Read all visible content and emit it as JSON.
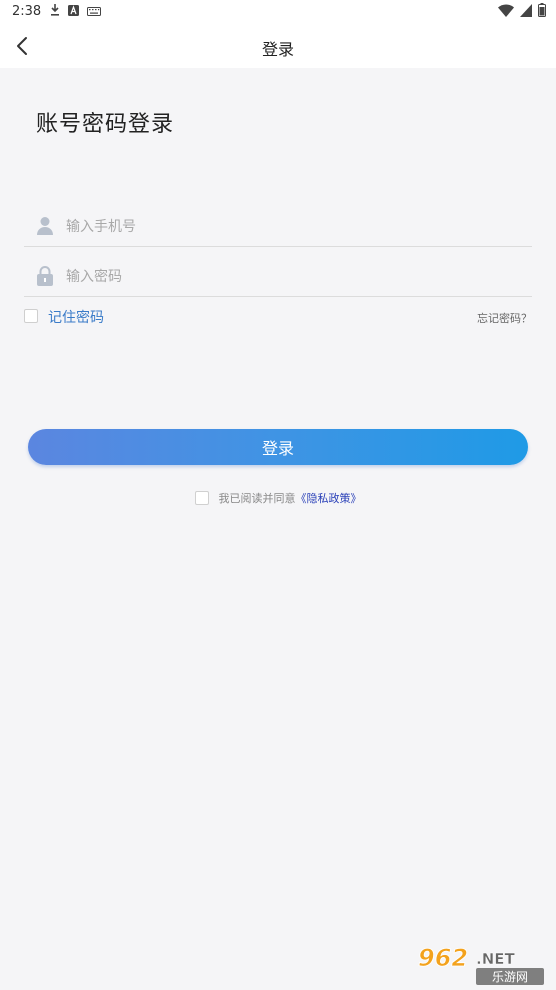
{
  "status_bar": {
    "time": "2:38",
    "icons_left": [
      "download-icon",
      "a-icon",
      "keyboard-icon"
    ],
    "icons_right": [
      "wifi-icon",
      "signal-icon",
      "battery-icon"
    ]
  },
  "nav": {
    "title": "登录",
    "back_icon": "chevron-left-icon"
  },
  "page": {
    "heading": "账号密码登录"
  },
  "form": {
    "phone": {
      "placeholder": "输入手机号",
      "value": "",
      "icon": "user-icon"
    },
    "password": {
      "placeholder": "输入密码",
      "value": "",
      "icon": "lock-icon"
    },
    "remember_label": "记住密码",
    "forgot_label": "忘记密码？",
    "login_label": "登录"
  },
  "agreement": {
    "text": "我已阅读并同意",
    "link": "《隐私政策》"
  },
  "watermark": {
    "logo_text": "962.NET",
    "sub_text": "乐游网"
  },
  "colors": {
    "accent_link": "#3a7bc8",
    "button_gradient_start": "#5b86e0",
    "button_gradient_end": "#1f9ae6",
    "privacy_link": "#2a40b8",
    "background": "#f5f5f7"
  }
}
